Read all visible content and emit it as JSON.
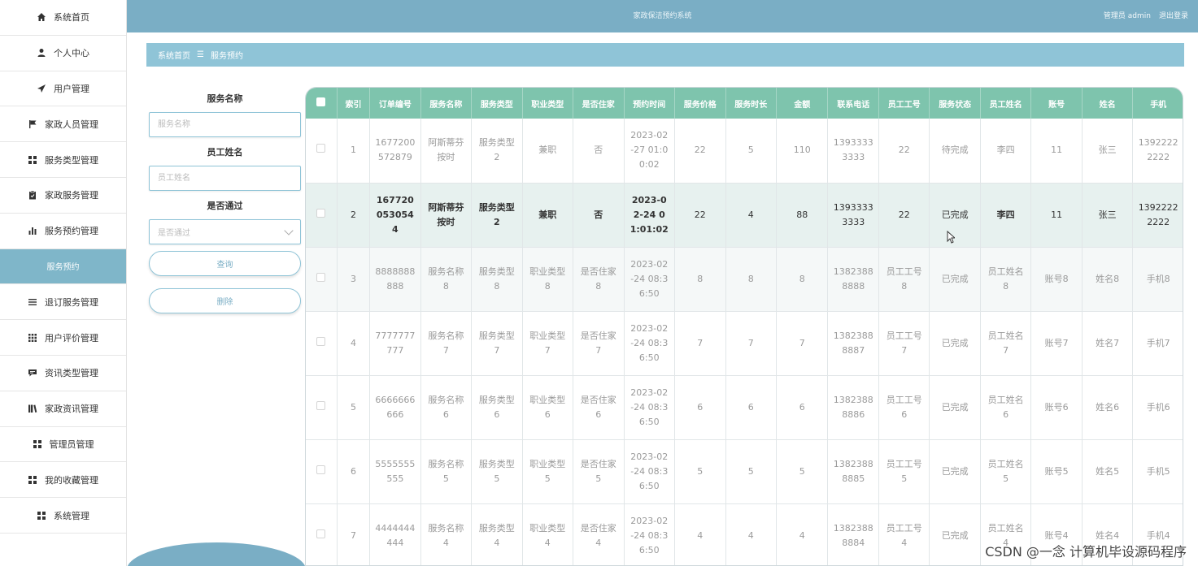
{
  "sidebar": {
    "items": [
      {
        "label": "系统首页",
        "icon": "home-icon"
      },
      {
        "label": "个人中心",
        "icon": "user-icon"
      },
      {
        "label": "用户管理",
        "icon": "send-icon"
      },
      {
        "label": "家政人员管理",
        "icon": "flag-icon"
      },
      {
        "label": "服务类型管理",
        "icon": "grid-icon"
      },
      {
        "label": "家政服务管理",
        "icon": "clipboard-icon"
      },
      {
        "label": "服务预约管理",
        "icon": "bar-chart-icon"
      },
      {
        "label": "服务预约",
        "icon": "",
        "active": true
      },
      {
        "label": "退订服务管理",
        "icon": "list-icon"
      },
      {
        "label": "用户评价管理",
        "icon": "grid-small-icon"
      },
      {
        "label": "资讯类型管理",
        "icon": "message-icon"
      },
      {
        "label": "家政资讯管理",
        "icon": "book-icon"
      },
      {
        "label": "管理员管理",
        "icon": "grid-icon"
      },
      {
        "label": "我的收藏管理",
        "icon": "grid-icon"
      },
      {
        "label": "系统管理",
        "icon": "grid-icon"
      }
    ]
  },
  "header": {
    "title": "家政保洁预约系统",
    "user": "管理员 admin",
    "logout": "退出登录"
  },
  "breadcrumb": {
    "home": "系统首页",
    "separator": "☰",
    "current": "服务预约"
  },
  "search": {
    "service_name_label": "服务名称",
    "service_name_placeholder": "服务名称",
    "employee_name_label": "员工姓名",
    "employee_name_placeholder": "员工姓名",
    "approved_label": "是否通过",
    "approved_placeholder": "是否通过",
    "query_button": "查询",
    "delete_button": "删除"
  },
  "table": {
    "headers": [
      "索引",
      "订单编号",
      "服务名称",
      "服务类型",
      "职业类型",
      "是否住家",
      "预约时间",
      "服务价格",
      "服务时长",
      "金额",
      "联系电话",
      "员工工号",
      "服务状态",
      "员工姓名",
      "账号",
      "姓名",
      "手机"
    ],
    "rows": [
      [
        "1",
        "1677200572879",
        "阿斯蒂芬按时",
        "服务类型2",
        "兼职",
        "否",
        "2023-02-27 01:00:02",
        "22",
        "5",
        "110",
        "13933333333",
        "22",
        "待完成",
        "李四",
        "11",
        "张三",
        "13922222222"
      ],
      [
        "2",
        "1677200530544",
        "阿斯蒂芬按时",
        "服务类型2",
        "兼职",
        "否",
        "2023-02-24 01:01:02",
        "22",
        "4",
        "88",
        "13933333333",
        "22",
        "已完成",
        "李四",
        "11",
        "张三",
        "13922222222"
      ],
      [
        "3",
        "8888888888",
        "服务名称8",
        "服务类型8",
        "职业类型8",
        "是否住家8",
        "2023-02-24 08:36:50",
        "8",
        "8",
        "8",
        "13823888888",
        "员工工号8",
        "已完成",
        "员工姓名8",
        "账号8",
        "姓名8",
        "手机8"
      ],
      [
        "4",
        "7777777777",
        "服务名称7",
        "服务类型7",
        "职业类型7",
        "是否住家7",
        "2023-02-24 08:36:50",
        "7",
        "7",
        "7",
        "13823888887",
        "员工工号7",
        "已完成",
        "员工姓名7",
        "账号7",
        "姓名7",
        "手机7"
      ],
      [
        "5",
        "6666666666",
        "服务名称6",
        "服务类型6",
        "职业类型6",
        "是否住家6",
        "2023-02-24 08:36:50",
        "6",
        "6",
        "6",
        "13823888886",
        "员工工号6",
        "已完成",
        "员工姓名6",
        "账号6",
        "姓名6",
        "手机6"
      ],
      [
        "6",
        "5555555555",
        "服务名称5",
        "服务类型5",
        "职业类型5",
        "是否住家5",
        "2023-02-24 08:36:50",
        "5",
        "5",
        "5",
        "13823888885",
        "员工工号5",
        "已完成",
        "员工姓名5",
        "账号5",
        "姓名5",
        "手机5"
      ],
      [
        "7",
        "4444444444",
        "服务名称4",
        "服务类型4",
        "职业类型4",
        "是否住家4",
        "2023-02-24 08:36:50",
        "4",
        "4",
        "4",
        "13823888884",
        "员工工号4",
        "已完成",
        "员工姓名4",
        "账号4",
        "姓名4",
        "手机4"
      ]
    ]
  },
  "watermark": "CSDN @一念 计算机毕设源码程序",
  "colors": {
    "header": "#7aaec5",
    "table_header": "#7ec4ad",
    "active_nav": "#7fb6c9"
  }
}
